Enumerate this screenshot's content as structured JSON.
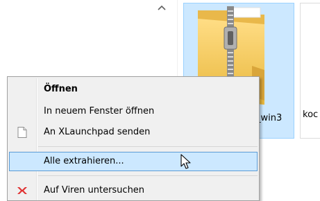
{
  "explorer": {
    "selected_file_label": "_win3",
    "next_file_label": "koc"
  },
  "context_menu": {
    "items": [
      {
        "label": "Öffnen",
        "icon": null
      },
      {
        "label": "In neuem Fenster öffnen",
        "icon": null
      },
      {
        "label": "An XLaunchpad senden",
        "icon": "document-icon"
      },
      {
        "label": "Alle extrahieren...",
        "icon": null
      },
      {
        "label": "Auf Viren untersuchen",
        "icon": "antivirus-icon"
      }
    ],
    "hovered_index": 3
  },
  "colors": {
    "selection_fill": "#cce8ff",
    "selection_border": "#99d1ff",
    "menu_background": "#f0f0f0",
    "menu_hover_border": "#5a9bd5"
  }
}
